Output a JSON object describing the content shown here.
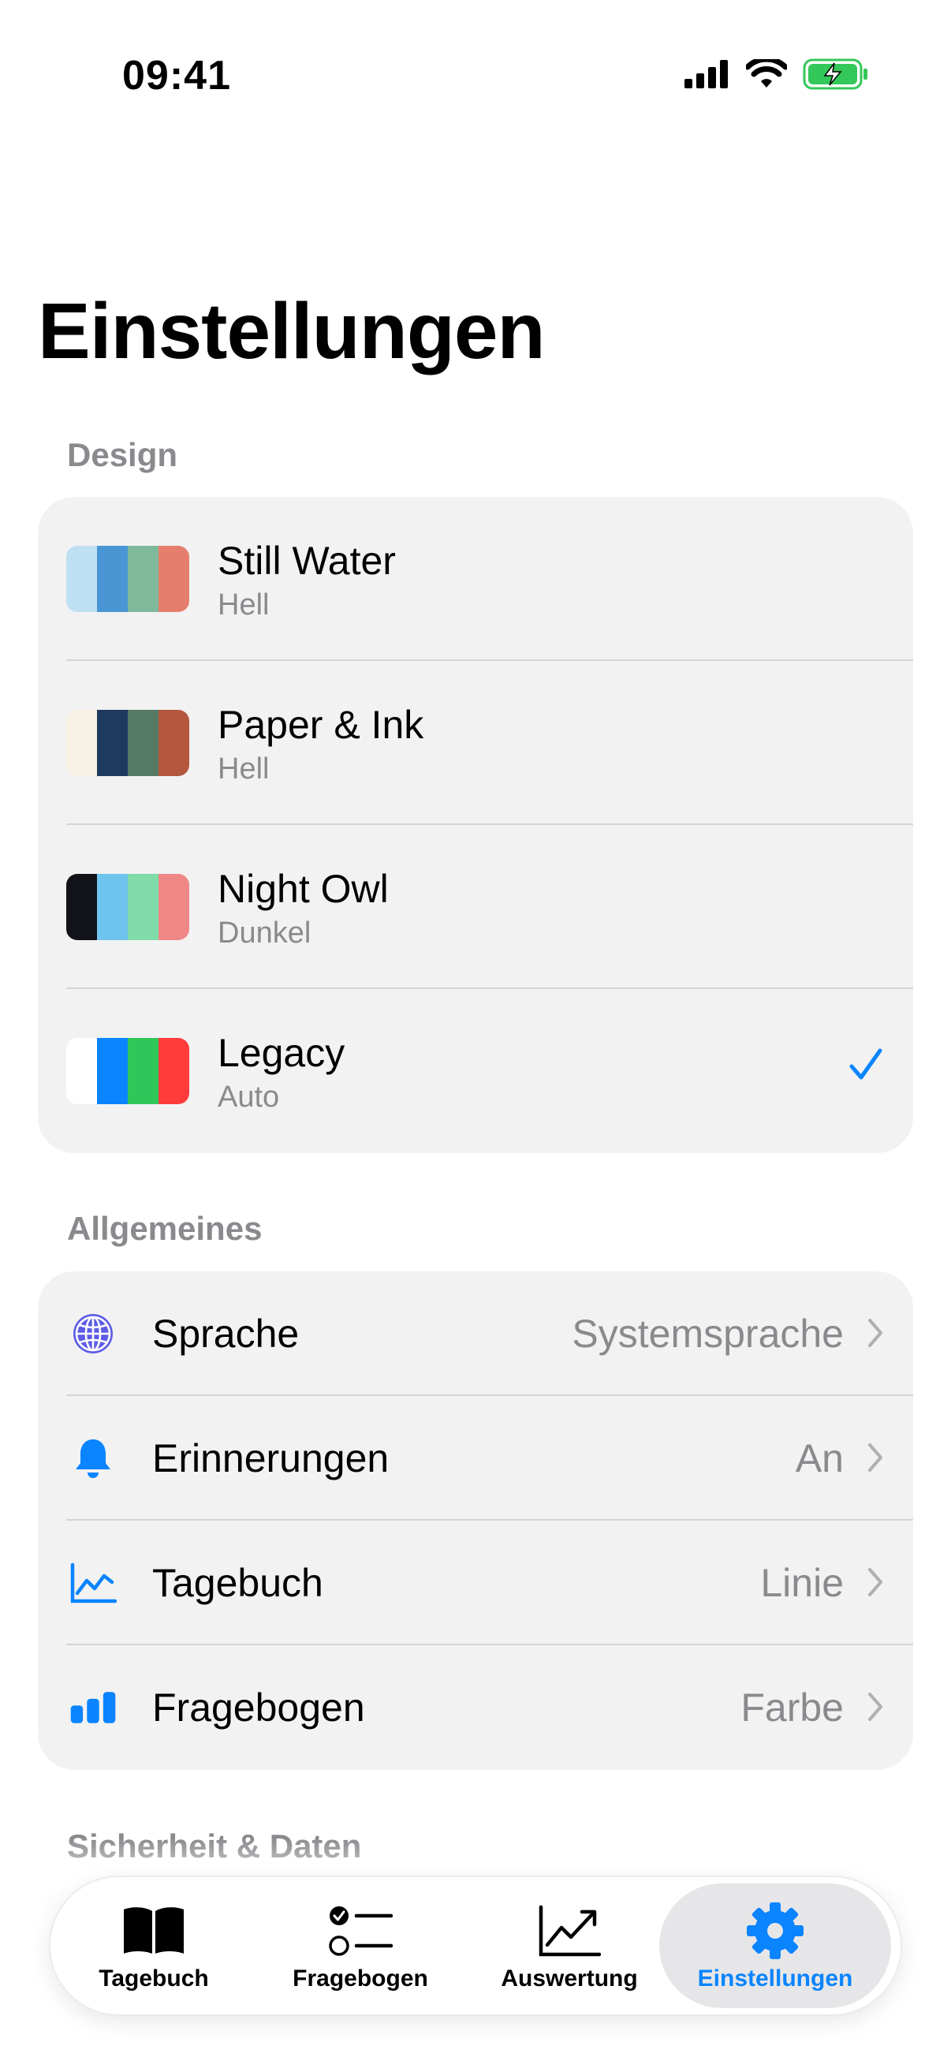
{
  "status_bar": {
    "time": "09:41"
  },
  "page": {
    "title": "Einstellungen"
  },
  "design": {
    "section_label": "Design",
    "themes": [
      {
        "name": "Still Water",
        "mode": "Hell",
        "colors": [
          "#bfe0f2",
          "#4a96d4",
          "#7fb89a",
          "#e67e6e"
        ],
        "selected": false
      },
      {
        "name": "Paper & Ink",
        "mode": "Hell",
        "colors": [
          "#f7f1e6",
          "#1f3a5f",
          "#557a66",
          "#b4573f"
        ],
        "selected": false
      },
      {
        "name": "Night Owl",
        "mode": "Dunkel",
        "colors": [
          "#111318",
          "#6ec4ec",
          "#7fdba8",
          "#f08787"
        ],
        "selected": false
      },
      {
        "name": "Legacy",
        "mode": "Auto",
        "colors": [
          "#ffffff",
          "#0a84ff",
          "#30c75a",
          "#ff3b3b"
        ],
        "selected": true
      }
    ]
  },
  "general": {
    "section_label": "Allgemeines",
    "items": [
      {
        "label": "Sprache",
        "value": "Systemsprache",
        "icon": "globe-icon",
        "icon_color": "#5e5ce6"
      },
      {
        "label": "Erinnerungen",
        "value": "An",
        "icon": "bell-icon",
        "icon_color": "#0a84ff"
      },
      {
        "label": "Tagebuch",
        "value": "Linie",
        "icon": "line-chart-icon",
        "icon_color": "#0a84ff"
      },
      {
        "label": "Fragebogen",
        "value": "Farbe",
        "icon": "bar-chart-icon",
        "icon_color": "#0a84ff"
      }
    ]
  },
  "security": {
    "section_label": "Sicherheit & Daten"
  },
  "tab_bar": {
    "tabs": [
      {
        "label": "Tagebuch",
        "icon": "book-icon",
        "active": false
      },
      {
        "label": "Fragebogen",
        "icon": "checklist-icon",
        "active": false
      },
      {
        "label": "Auswertung",
        "icon": "trend-chart-icon",
        "active": false
      },
      {
        "label": "Einstellungen",
        "icon": "gear-icon",
        "active": true
      }
    ]
  },
  "colors": {
    "accent": "#0a84ff",
    "secondary_text": "#8a8a8e",
    "card_background": "#f2f2f2",
    "battery": "#34c759"
  }
}
